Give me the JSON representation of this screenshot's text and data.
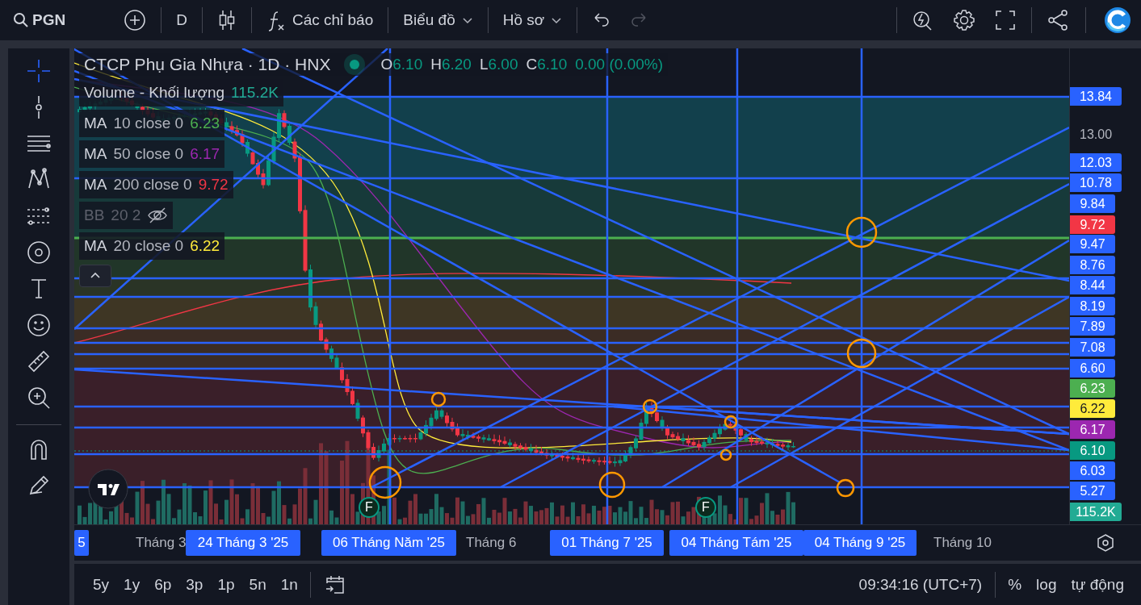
{
  "toolbar": {
    "symbol": "PGN",
    "interval": "D",
    "indicators_label": "Các chỉ báo",
    "chart_menu": "Biểu đồ",
    "profile_menu": "Hồ sơ",
    "redo_disabled": true
  },
  "tools": [
    {
      "kind": "crosshair",
      "selected": true
    },
    {
      "kind": "trendline",
      "selected": false
    },
    {
      "kind": "fib",
      "selected": false
    },
    {
      "kind": "pattern",
      "selected": false
    },
    {
      "kind": "projection",
      "selected": false
    },
    {
      "kind": "brush",
      "selected": false
    },
    {
      "kind": "text",
      "selected": false
    },
    {
      "kind": "emoji",
      "selected": false
    },
    {
      "kind": "ruler",
      "selected": false
    },
    {
      "kind": "zoom",
      "selected": false
    },
    {
      "kind": "magnet",
      "selected": false
    },
    {
      "kind": "pencil",
      "selected": false
    }
  ],
  "legend": {
    "title": "CTCP Phụ Gia Nhựa · 1D · HNX",
    "market_open": true,
    "ohlc": [
      {
        "key": "O",
        "value": "6.10"
      },
      {
        "key": "H",
        "value": "6.20"
      },
      {
        "key": "L",
        "value": "6.00"
      },
      {
        "key": "C",
        "value": "6.10"
      }
    ],
    "change": "0.00 (0.00%)"
  },
  "indicators": [
    {
      "name": "Volume - Khối lượng",
      "value": "115.2K",
      "color": "#22ab94",
      "hidden": false
    },
    {
      "name": "MA",
      "params": "10 close 0",
      "value": "6.23",
      "color": "#4caf50",
      "hidden": false
    },
    {
      "name": "MA",
      "params": "50 close 0",
      "value": "6.17",
      "color": "#9c27b0",
      "hidden": false
    },
    {
      "name": "MA",
      "params": "200 close 0",
      "value": "9.72",
      "color": "#f23645",
      "hidden": false
    },
    {
      "name": "BB",
      "params": "20 2",
      "hidden": true
    },
    {
      "name": "MA",
      "params": "20 close 0",
      "value": "6.22",
      "color": "#ffeb3b",
      "hidden": false
    }
  ],
  "events": [
    {
      "label": "F"
    },
    {
      "label": "F"
    }
  ],
  "price_axis": [
    {
      "kind": "label",
      "text": "13.84",
      "color": "#2962ff"
    },
    {
      "kind": "tick",
      "text": "13.00"
    },
    {
      "kind": "label",
      "text": "12.03",
      "color": "#2962ff"
    },
    {
      "kind": "label",
      "text": "10.78",
      "color": "#2962ff"
    },
    {
      "kind": "label",
      "text": "9.84",
      "color": "#2962ff"
    },
    {
      "kind": "label",
      "text": "9.72",
      "color": "#f23645"
    },
    {
      "kind": "label",
      "text": "9.47",
      "color": "#2962ff"
    },
    {
      "kind": "label",
      "text": "8.76",
      "color": "#2962ff"
    },
    {
      "kind": "label",
      "text": "8.44",
      "color": "#2962ff"
    },
    {
      "kind": "label",
      "text": "8.19",
      "color": "#2962ff"
    },
    {
      "kind": "label",
      "text": "7.89",
      "color": "#2962ff"
    },
    {
      "kind": "label",
      "text": "7.08",
      "color": "#2962ff"
    },
    {
      "kind": "label",
      "text": "6.60",
      "color": "#2962ff"
    },
    {
      "kind": "label",
      "text": "6.23",
      "color": "#4caf50"
    },
    {
      "kind": "label",
      "text": "6.22",
      "color": "#ffeb3b"
    },
    {
      "kind": "label",
      "text": "6.17",
      "color": "#9c27b0"
    },
    {
      "kind": "label",
      "text": "6.10",
      "color": "#089981"
    },
    {
      "kind": "label",
      "text": "6.03",
      "color": "#2962ff"
    },
    {
      "kind": "label",
      "text": "5.27",
      "color": "#2962ff"
    },
    {
      "kind": "label",
      "text": "115.2K",
      "color": "#22ab94"
    }
  ],
  "time_axis": [
    {
      "text": "5",
      "highlighted": true
    },
    {
      "text": "Tháng 3",
      "highlighted": false
    },
    {
      "text": "24 Tháng 3 '25",
      "highlighted": true
    },
    {
      "text": "06 Tháng Năm '25",
      "highlighted": true
    },
    {
      "text": "Tháng 6",
      "highlighted": false
    },
    {
      "text": "01 Tháng 7 '25",
      "highlighted": true
    },
    {
      "text": "04 Tháng Tám '25",
      "highlighted": true
    },
    {
      "text": "04 Tháng 9 '25",
      "highlighted": true
    },
    {
      "text": "Tháng 10",
      "highlighted": false
    }
  ],
  "ranges": [
    "5y",
    "1y",
    "6p",
    "3p",
    "1p",
    "5n",
    "1n"
  ],
  "bottom_bar": {
    "time": "09:34:16 (UTC+7)",
    "percent": "%",
    "log": "log",
    "auto": "tự động"
  }
}
